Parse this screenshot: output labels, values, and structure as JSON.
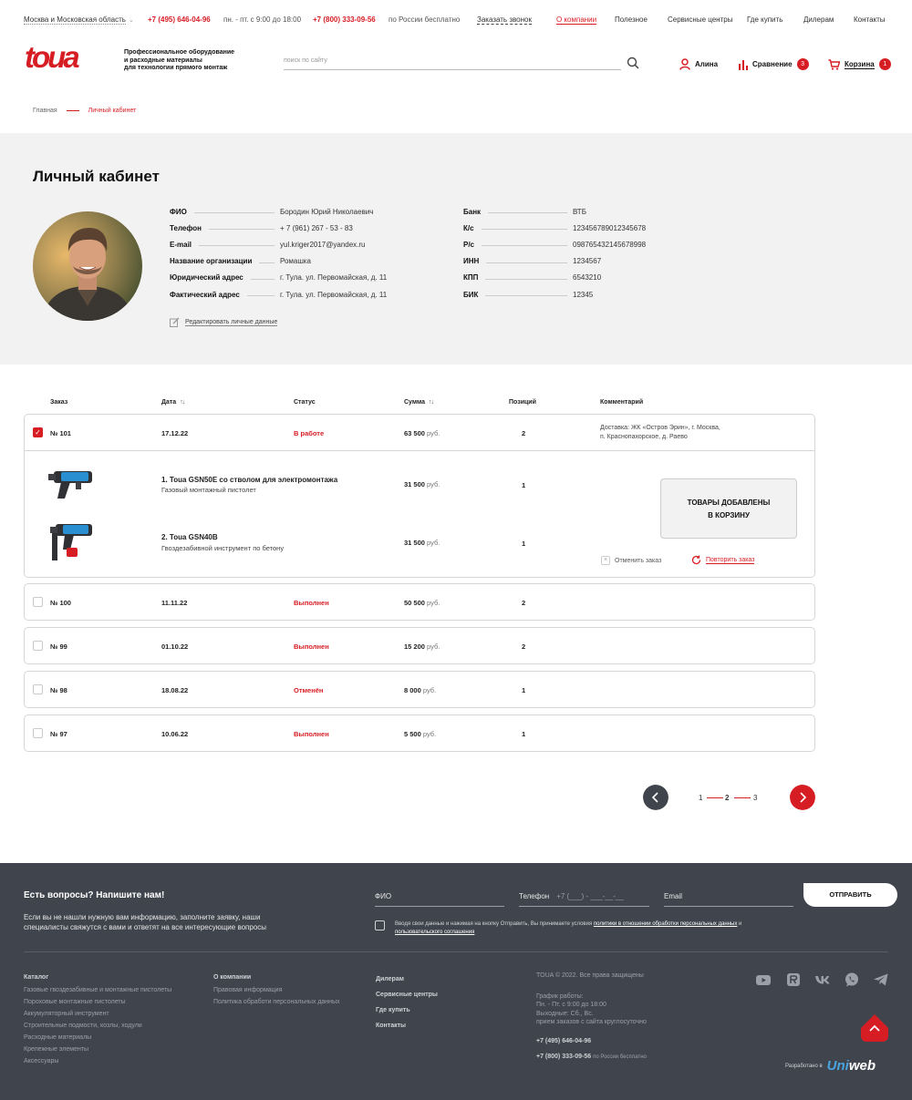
{
  "topbar": {
    "region": "Москва и Московская область",
    "phone1": "+7 (495) 646-04-96",
    "hours": "пн. - пт. с 9:00 до 18:00",
    "phone2": "+7 (800) 333-09-56",
    "phone2_note": "по России бесплатно",
    "callback": "Заказать звонок",
    "nav": [
      "О компании",
      "Полезное",
      "Сервисные центры",
      "Где купить",
      "Дилерам",
      "Контакты"
    ]
  },
  "header": {
    "logo": "toua",
    "tagline": [
      "Профессиональное оборудование",
      "и расходные материалы",
      "для технологии прямого монтаж"
    ],
    "search_placeholder": "поиск по сайту",
    "user": "Алина",
    "compare_label": "Сравнение",
    "compare_count": "3",
    "cart_label": "Корзина",
    "cart_count": "1"
  },
  "breadcrumb": {
    "home": "Главная",
    "current": "Личный кабинет"
  },
  "profile": {
    "title": "Личный кабинет",
    "left": [
      {
        "label": "ФИО",
        "value": "Бородин Юрий Николаевич"
      },
      {
        "label": "Телефон",
        "value": "+ 7 (961) 267 - 53 - 83"
      },
      {
        "label": "E-mail",
        "value": "yul.kriger2017@yandex.ru"
      },
      {
        "label": "Название организации",
        "value": "Ромашка"
      },
      {
        "label": "Юридический адрес",
        "value": "г. Тула. ул. Первомайская, д. 11"
      },
      {
        "label": "Фактический адрес",
        "value": "г. Тула. ул. Первомайская, д. 11"
      }
    ],
    "right": [
      {
        "label": "Банк",
        "value": "ВТБ"
      },
      {
        "label": "К/с",
        "value": "123456789012345678"
      },
      {
        "label": "Р/с",
        "value": "098765432145678998"
      },
      {
        "label": "ИНН",
        "value": "1234567"
      },
      {
        "label": "КПП",
        "value": "6543210"
      },
      {
        "label": "БИК",
        "value": "12345"
      }
    ],
    "edit_link": "Редактировать личные данные"
  },
  "orders": {
    "headers": {
      "order": "Заказ",
      "date": "Дата",
      "status": "Статус",
      "sum": "Сумма",
      "items": "Позиций",
      "comment": "Комментарий"
    },
    "currency": "руб.",
    "expanded": {
      "number": "№ 101",
      "date": "17.12.22",
      "status": "В работе",
      "sum": "63 500",
      "items": "2",
      "comment_line1": "Доставка: ЖК «Остров Эрин», г. Москва,",
      "comment_line2": "п. Краснопахорское, д. Раево",
      "products": [
        {
          "name": "1. Toua GSN50E со стволом для электромонтажа",
          "desc": "Газовый монтажный пистолет",
          "sum": "31 500",
          "qty": "1"
        },
        {
          "name": "2. Toua GSN40B",
          "desc": "Гвоздезабивной инструмент по бетону",
          "sum": "31 500",
          "qty": "1"
        }
      ],
      "added_line1": "ТОВАРЫ ДОБАВЛЕНЫ",
      "added_line2": "В КОРЗИНУ",
      "cancel": "Отменить заказ",
      "repeat": "Повторить заказ"
    },
    "rows": [
      {
        "number": "№ 100",
        "date": "11.11.22",
        "status": "Выполнен",
        "sum": "50 500",
        "items": "2"
      },
      {
        "number": "№ 99",
        "date": "01.10.22",
        "status": "Выполнен",
        "sum": "15 200",
        "items": "2"
      },
      {
        "number": "№ 98",
        "date": "18.08.22",
        "status": "Отменён",
        "sum": "8 000",
        "items": "1"
      },
      {
        "number": "№ 97",
        "date": "10.06.22",
        "status": "Выполнен",
        "sum": "5 500",
        "items": "1"
      }
    ]
  },
  "pagination": {
    "pages": [
      "1",
      "2",
      "3"
    ],
    "current": "2"
  },
  "footer": {
    "title": "Есть вопросы? Напишите нам!",
    "desc": "Если вы не нашли нужную вам информацию, заполните заявку, наши специалисты свяжутся с вами и ответят на все интересующие вопросы",
    "field_name": "ФИО",
    "field_phone": "Телефон",
    "phone_placeholder": "+7 (___) - ___-__-__",
    "field_email": "Email",
    "send": "ОТПРАВИТЬ",
    "agree_text": "Вводя свои данные и нажимая на кнопку Отправить, Вы принимаете условия",
    "agree_link1": "политики в отношении обработки персональных данных",
    "agree_and": "и",
    "agree_link2": "пользовательского соглашения",
    "catalog_title": "Каталог",
    "catalog": [
      "Газовые гвоздезабивные и монтажные пистолеты",
      "Пороховые монтажные пистолеты",
      "Аккумуляторный инструмент",
      "Строительные подмости, козлы, ходули",
      "Расходные материалы",
      "Крепежные элементы",
      "Аксессуары"
    ],
    "company_title": "О компании",
    "company": [
      "Правовая информация",
      "Политика обработи персональных данных"
    ],
    "links": [
      "Дилерам",
      "Сервисные центры",
      "Где купить",
      "Контакты"
    ],
    "copyright": "TOUA © 2022. Все права защищены",
    "schedule": [
      "График работы:",
      "Пн. - Пт. с 9:00 до 18:00",
      "Выходные: Сб., Вс.",
      "прием заказов с сайта круглосуточно"
    ],
    "phone1": "+7 (495) 646-04-96",
    "phone2": "+7 (800) 333-09-56",
    "phone2_note": "по России бесплатно",
    "dev_label": "Разработано в",
    "dev_brand_a": "Uni",
    "dev_brand_b": "web"
  },
  "colors": {
    "accent": "#d71d24",
    "footer_bg": "#40454d",
    "profile_bg": "#f2f2f2"
  }
}
